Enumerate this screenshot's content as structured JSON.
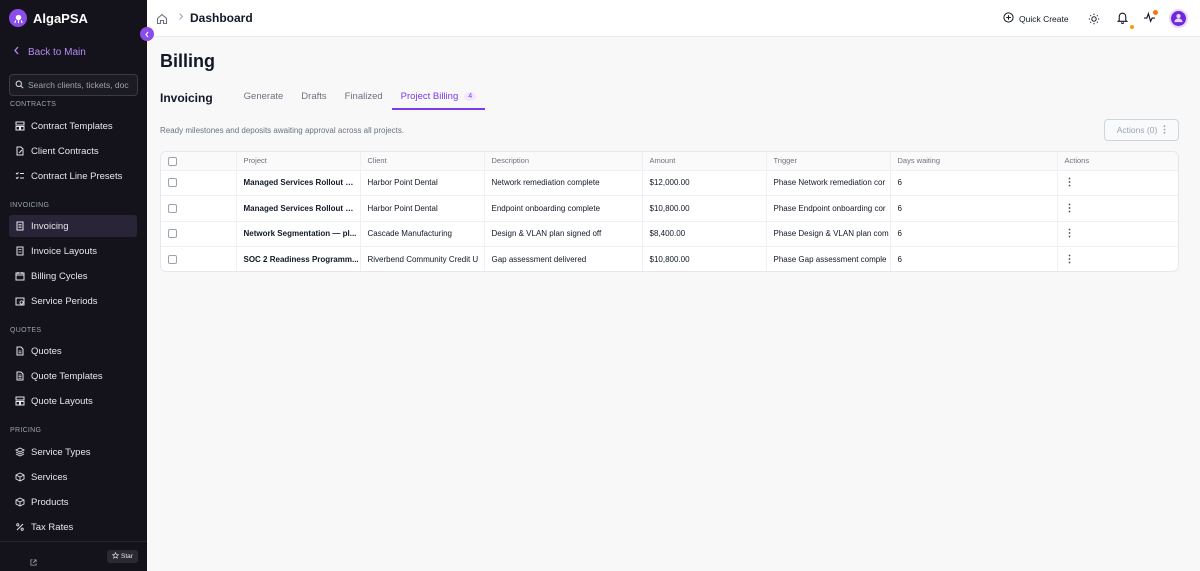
{
  "app": {
    "name": "AlgaPSA"
  },
  "sidebar": {
    "back_label": "Back to Main",
    "search_placeholder": "Search clients, tickets, doc",
    "sections": {
      "contracts": "CONTRACTS",
      "invoicing": "INVOICING",
      "quotes": "QUOTES",
      "pricing": "PRICING"
    },
    "items": {
      "contract_templates": "Contract Templates",
      "client_contracts": "Client Contracts",
      "contract_line_presets": "Contract Line Presets",
      "invoicing": "Invoicing",
      "invoice_layouts": "Invoice Layouts",
      "billing_cycles": "Billing Cycles",
      "service_periods": "Service Periods",
      "quotes": "Quotes",
      "quote_templates": "Quote Templates",
      "quote_layouts": "Quote Layouts",
      "service_types": "Service Types",
      "services": "Services",
      "products": "Products",
      "tax_rates": "Tax Rates"
    },
    "star_label": "Star"
  },
  "topbar": {
    "breadcrumb_title": "Dashboard",
    "quick_create": "Quick Create"
  },
  "page": {
    "title": "Billing",
    "tabs_heading": "Invoicing",
    "tabs": [
      "Generate",
      "Drafts",
      "Finalized",
      "Project Billing"
    ],
    "active_tab_count": "4",
    "subtitle": "Ready milestones and deposits awaiting approval across all projects.",
    "actions_button": "Actions (0)"
  },
  "table": {
    "columns": [
      "Project",
      "Client",
      "Description",
      "Amount",
      "Trigger",
      "Days waiting",
      "Actions"
    ],
    "rows": [
      {
        "project": "Managed Services Rollout —...",
        "client": "Harbor Point Dental",
        "description": "Network remediation complete",
        "amount": "$12,000.00",
        "trigger": "Phase Network remediation cor",
        "days": "6"
      },
      {
        "project": "Managed Services Rollout —...",
        "client": "Harbor Point Dental",
        "description": "Endpoint onboarding complete",
        "amount": "$10,800.00",
        "trigger": "Phase Endpoint onboarding cor",
        "days": "6"
      },
      {
        "project": "Network Segmentation — pl...",
        "client": "Cascade Manufacturing",
        "description": "Design & VLAN plan signed off",
        "amount": "$8,400.00",
        "trigger": "Phase Design & VLAN plan com",
        "days": "6"
      },
      {
        "project": "SOC 2 Readiness Programm...",
        "client": "Riverbend Community Credit U",
        "description": "Gap assessment delivered",
        "amount": "$10,800.00",
        "trigger": "Phase Gap assessment comple",
        "days": "6"
      }
    ]
  },
  "colors": {
    "accent": "#7c3aed",
    "sidebar_bg": "#14131b",
    "notification": "#f59e0b"
  }
}
